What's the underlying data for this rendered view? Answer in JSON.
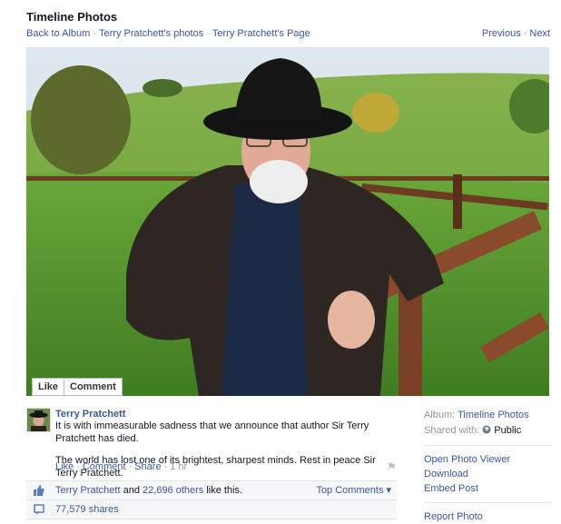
{
  "header": {
    "title": "Timeline Photos",
    "breadcrumbs": [
      "Back to Album",
      "Terry Pratchett's photos",
      "Terry Pratchett's Page"
    ],
    "sep": "·",
    "previous": "Previous",
    "next": "Next"
  },
  "photo": {
    "like_label": "Like",
    "comment_label": "Comment"
  },
  "post": {
    "author": "Terry Pratchett",
    "paragraphs": [
      "It is with immeasurable sadness that we announce that author Sir Terry Pratchett has died.",
      "The world has lost one of its brightest, sharpest minds. Rest in peace Sir Terry Pratchett."
    ],
    "actions": {
      "like": "Like",
      "comment": "Comment",
      "share": "Share",
      "time": "1 hr"
    }
  },
  "ufi": {
    "likers_name": "Terry Pratchett",
    "likers_and": " and ",
    "likers_others": "22,696 others",
    "likers_suffix": " like this.",
    "top_comments": "Top Comments ▾",
    "shares": "77,579 shares"
  },
  "sidebar": {
    "album_label": "Album:",
    "album_name": "Timeline Photos",
    "shared_label": "Shared with:",
    "shared_value": "Public",
    "options": [
      "Open Photo Viewer",
      "Download",
      "Embed Post",
      "Report Photo"
    ]
  },
  "colors": {
    "link": "#3b5998",
    "muted": "#9197a3",
    "ufi_bg": "#f6f7f8"
  }
}
